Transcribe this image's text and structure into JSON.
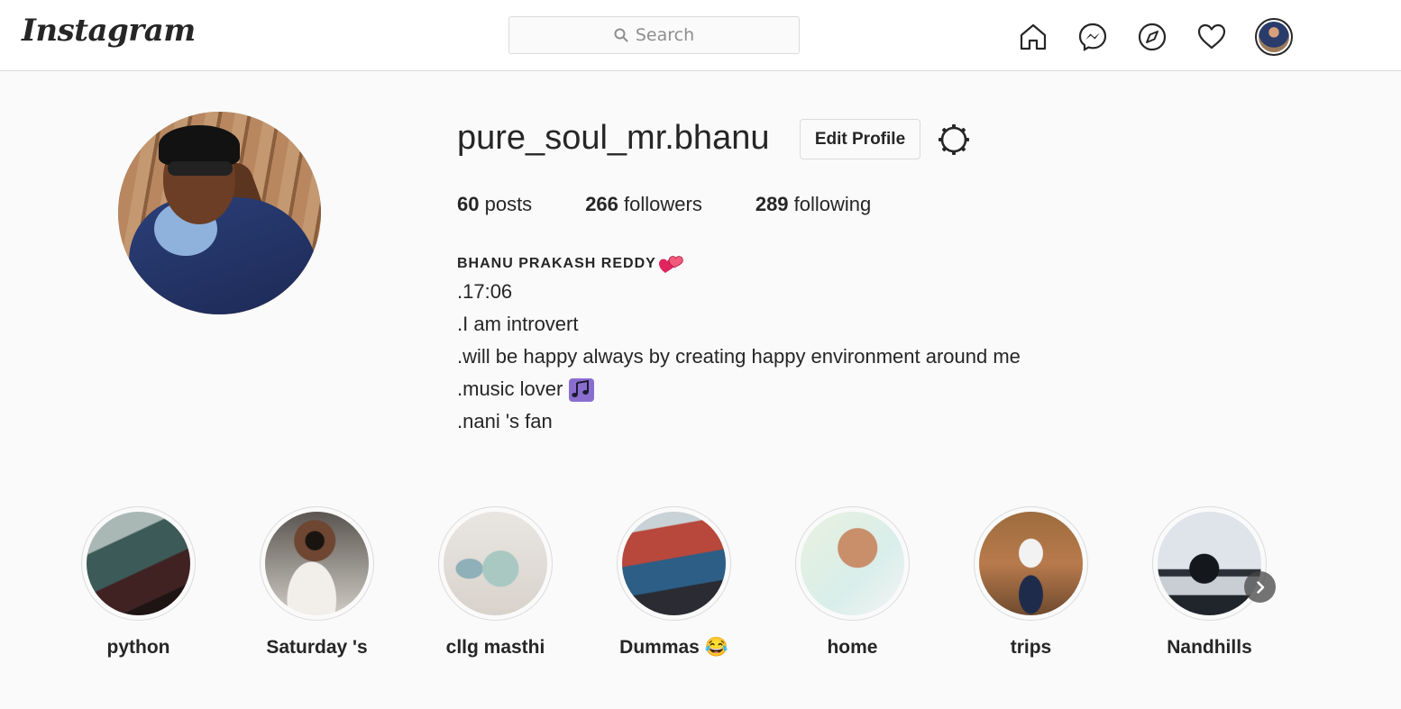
{
  "header": {
    "logo_text": "Instagram",
    "search_placeholder": "Search",
    "icons": [
      "home-icon",
      "messenger-icon",
      "explore-icon",
      "activity-heart-icon",
      "profile-avatar"
    ]
  },
  "profile": {
    "username": "pure_soul_mr.bhanu",
    "edit_profile_label": "Edit Profile",
    "stats": {
      "posts_count": "60",
      "posts_label": " posts",
      "followers_count": "266",
      "followers_label": " followers",
      "following_count": "289",
      "following_label": " following"
    },
    "bio": {
      "display_name": "BHANU PRAKASH REDDY",
      "lines": [
        ".17:06",
        ".I am introvert",
        ".will be happy always by creating happy environment around me",
        ".music lover",
        ".nani 's fan"
      ]
    }
  },
  "highlights": [
    {
      "label": "python"
    },
    {
      "label": "Saturday 's"
    },
    {
      "label": "cllg masthi"
    },
    {
      "label": "Dummas 😂"
    },
    {
      "label": "home"
    },
    {
      "label": "trips"
    },
    {
      "label": "Nandhills"
    }
  ],
  "colors": {
    "text": "#262626",
    "border": "#dbdbdb",
    "background": "#fafafa",
    "secondary_text": "#8e8e8e"
  }
}
